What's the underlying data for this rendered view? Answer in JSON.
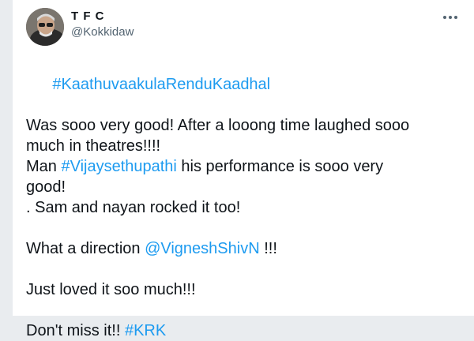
{
  "account": {
    "name": "T F C",
    "handle": "@Kokkidaw"
  },
  "tweet": {
    "hashtag_title": "#KaathuvaakulaRenduKaadhal",
    "line1": "Was sooo very good! After a looong time laughed sooo",
    "line2": "much in theatres!!!!",
    "line3_pre": "Man ",
    "line3_tag": "#Vijaysethupathi",
    "line3_post": " his performance is sooo very",
    "line4": "good!",
    "line5": ". Sam and nayan rocked it too!",
    "line6_pre": "What a direction ",
    "line6_mention": "@VigneshShivN",
    "line6_post": " !!!",
    "line7": "Just loved it soo much!!!",
    "line8_pre": "Don't miss it!! ",
    "line8_tag": "#KRK"
  },
  "icons": {
    "avatar": "user-avatar",
    "more": "more-options-icon"
  },
  "colors": {
    "link": "#1d9bf0",
    "text": "#0f1419",
    "secondary": "#536471"
  }
}
